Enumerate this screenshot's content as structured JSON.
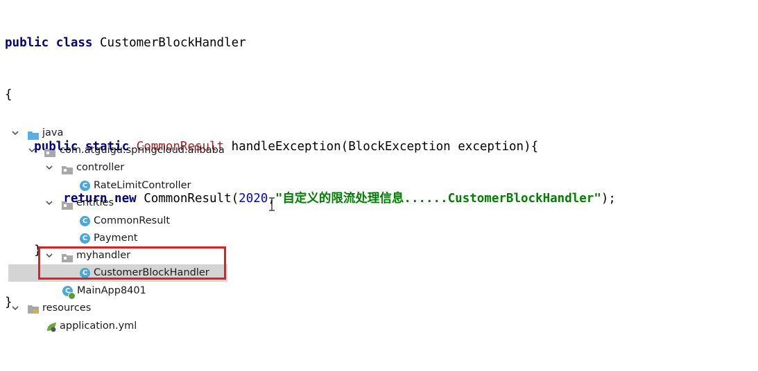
{
  "code": {
    "line1": {
      "kw": "public class ",
      "name": "CustomerBlockHandler"
    },
    "line2": "{",
    "line3": {
      "kw1": "public static ",
      "type": "CommonResult",
      "rest": " handleException(BlockException exception){"
    },
    "line4": {
      "kw": "return new ",
      "call": "CommonResult(",
      "num": "2020",
      "comma": ",",
      "str": "\"自定义的限流处理信息......CustomerBlockHandler\"",
      "end": ");"
    },
    "line5": "}",
    "line6": "}"
  },
  "tree": {
    "java": "java",
    "package": "com.atguigu.springcloud.alibaba",
    "controller": "controller",
    "rate_limit_controller": "RateLimitController",
    "entities": "entities",
    "common_result": "CommonResult",
    "payment": "Payment",
    "myhandler": "myhandler",
    "customer_block_handler": "CustomerBlockHandler",
    "main_app": "MainApp8401",
    "resources": "resources",
    "application_yml": "application.yml",
    "class_icon_letter": "C"
  },
  "colors": {
    "keyword": "#000080",
    "type": "#b02020",
    "number": "#0000ff",
    "string": "#008000",
    "highlight_border": "#e02020",
    "selection": "#d4d4d4",
    "class_icon": "#48a8d8"
  }
}
